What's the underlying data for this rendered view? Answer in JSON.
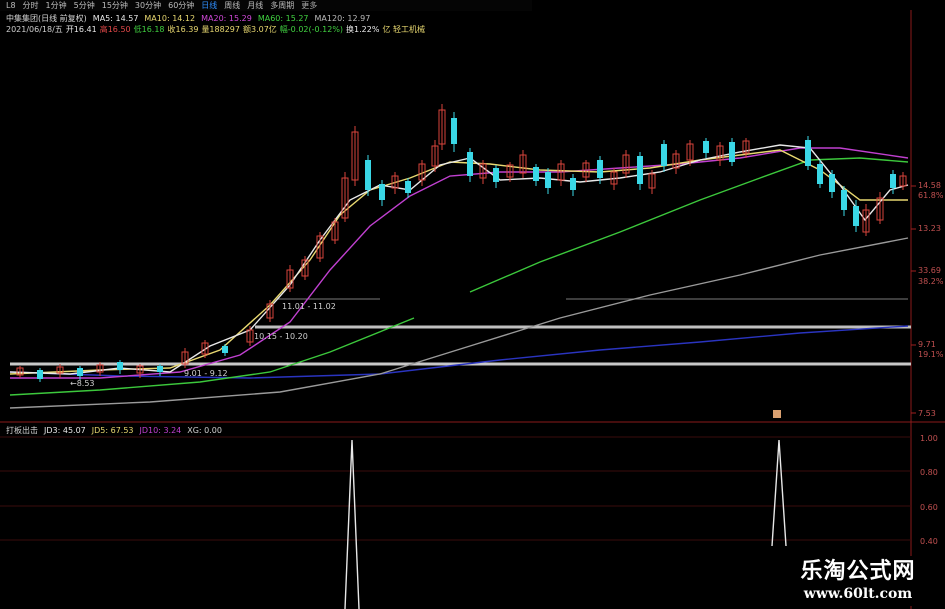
{
  "timeframe_tabs": [
    "分时",
    "1分钟",
    "5分钟",
    "15分钟",
    "30分钟",
    "60分钟",
    "日线",
    "周线",
    "月线",
    "多周期",
    "更多"
  ],
  "active_tab": "日线",
  "stock": {
    "name": "中集集团(日线 前复权)",
    "ma5": "MA5: 14.57",
    "ma10": "MA10: 14.12",
    "ma20": "MA20: 15.29",
    "ma60": "MA60: 15.27",
    "ma120": "MA120: 12.97"
  },
  "bar_info": {
    "date": "2021/06/18/五",
    "open": "开16.41",
    "high": "高16.50",
    "low": "低16.18",
    "close": "收16.39",
    "volume": "量188297",
    "amount": "额3.07亿",
    "change": "幅-0.02(-0.12%)",
    "turnover": "换1.22%",
    "sector": "亿 轻工机械"
  },
  "price_axis": [
    "14.58",
    "61.8%",
    "13.23",
    "33.69",
    "38.2%",
    "9.71",
    "19.1%",
    "7.53"
  ],
  "chart_annotations": [
    "11.01 - 11.02",
    "10.15 - 10.20",
    "9.01 - 9.12",
    "←8.53"
  ],
  "indicator": {
    "name": "打板出击",
    "jd3": "JD3: 45.07",
    "jd5": "JD5: 67.53",
    "jd10": "JD10: 3.24",
    "xg": "XG: 0.00"
  },
  "indicator_axis": [
    "1.00",
    "0.80",
    "0.60",
    "0.40"
  ],
  "watermark": {
    "title": "乐淘公式网",
    "url": "www.60lt.com"
  },
  "colors": {
    "up": "#d9453c",
    "down": "#3ad7e6",
    "ma5": "#e8e8e8",
    "ma10": "#e8d870",
    "ma20": "#c040d0",
    "ma60": "#40d040",
    "ma120": "#9a9a9a",
    "ma250": "#2c36c8",
    "active_tab": "#2f8fff"
  }
}
